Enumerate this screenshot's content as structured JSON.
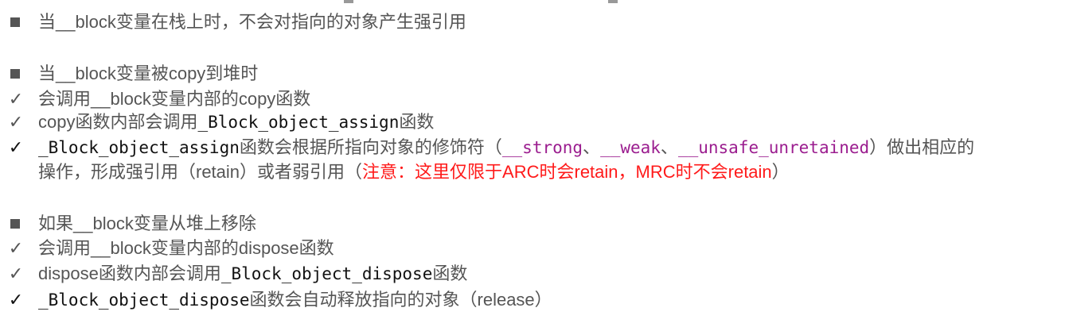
{
  "sections": [
    {
      "heading": "当__block变量在栈上时，不会对指向的对象产生强引用"
    },
    {
      "heading": "当__block变量被copy到堆时",
      "item1": "会调用__block变量内部的copy函数",
      "item2_text": "copy函数内部会调用",
      "item2_code": "_Block_object_assign",
      "item2_tail": "函数",
      "item3_code": "_Block_object_assign",
      "item3_text": "函数会根据所指向对象的修饰符（",
      "item3_kw1": "__strong",
      "sep1": "、",
      "item3_kw2": "__weak",
      "sep2": "、",
      "item3_kw3": "__unsafe_unretained",
      "item3_tail": "）做出相应的",
      "item3_line2": "操作，形成强引用（retain）或者弱引用（",
      "item3_note": "注意：这里仅限于ARC时会retain，MRC时不会retain",
      "item3_close": "）"
    },
    {
      "heading": "如果__block变量从堆上移除",
      "item1": "会调用__block变量内部的dispose函数",
      "item2_text": "dispose函数内部会调用",
      "item2_code": "_Block_object_dispose",
      "item2_tail": "函数",
      "item3_code": "_Block_object_dispose",
      "item3_text": "函数会自动释放指向的对象（release）"
    }
  ],
  "check_glyph": "✓",
  "colors": {
    "text": "#555555",
    "code": "#111111",
    "keyword": "#9b1d8f",
    "note": "#ff1a1a"
  }
}
